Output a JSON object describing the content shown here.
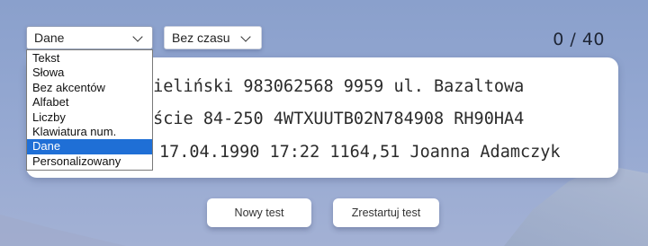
{
  "mode_select": {
    "value": "Dane",
    "options": [
      "Tekst",
      "Słowa",
      "Bez akcentów",
      "Alfabet",
      "Liczby",
      "Klawiatura num.",
      "Dane",
      "Personalizowany"
    ],
    "selected_index": 6
  },
  "time_select": {
    "value": "Bez czasu"
  },
  "counter": "0 / 40",
  "text_lines": [
    "Zieliński 983062568 9959 ul. Bazaltowa",
    "jście 84-250 4WTXUUTB02N784908 RH90HA4",
    "17.04.1990 17:22 1164,51 Joanna Adamczyk"
  ],
  "buttons": {
    "new_test": "Nowy test",
    "restart_test": "Zrestartuj test"
  },
  "colors": {
    "selected_option": "#1f6fd6",
    "background": "#8aa0cc"
  }
}
